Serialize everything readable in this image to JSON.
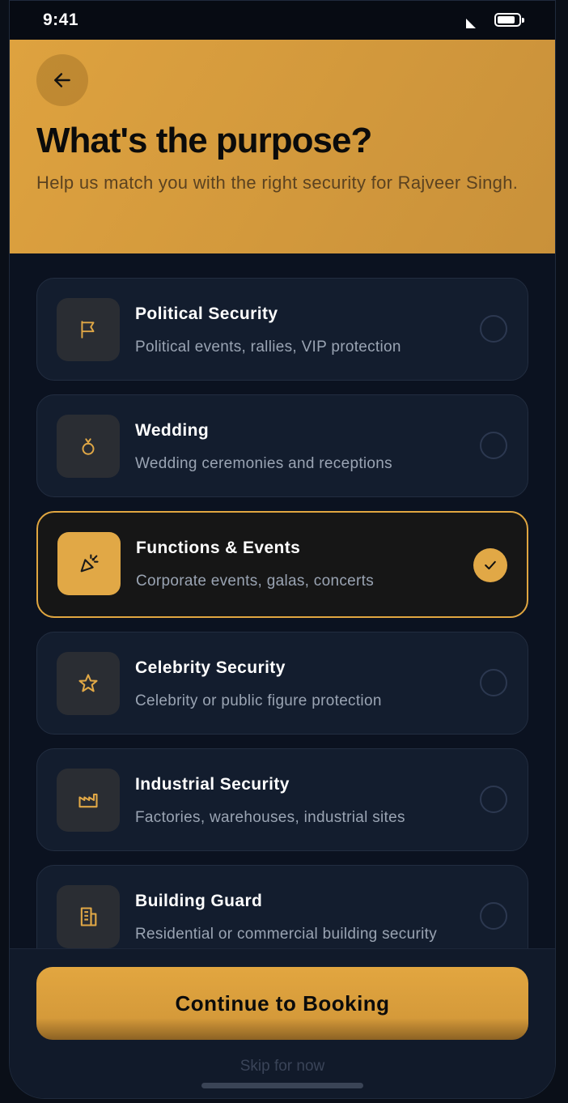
{
  "status_bar": {
    "time": "9:41"
  },
  "header": {
    "title": "What's the purpose?",
    "subtitle": "Help us match you with the right security for Rajveer Singh."
  },
  "options": [
    {
      "title": "Political Security",
      "description": "Political events, rallies, VIP protection",
      "icon": "flag-icon",
      "selected": false
    },
    {
      "title": "Wedding",
      "description": "Wedding ceremonies and receptions",
      "icon": "ring-icon",
      "selected": false
    },
    {
      "title": "Functions & Events",
      "description": "Corporate events, galas, concerts",
      "icon": "party-popper-icon",
      "selected": true
    },
    {
      "title": "Celebrity Security",
      "description": "Celebrity or public figure protection",
      "icon": "star-icon",
      "selected": false
    },
    {
      "title": "Industrial Security",
      "description": "Factories, warehouses, industrial sites",
      "icon": "factory-icon",
      "selected": false
    },
    {
      "title": "Building Guard",
      "description": "Residential or commercial building security",
      "icon": "building-icon",
      "selected": false
    }
  ],
  "footer": {
    "cta_label": "Continue to Booking",
    "skip_label": "Skip for now"
  },
  "colors": {
    "accent": "#e1a846",
    "background": "#0b1220",
    "card": "#131d2e"
  }
}
